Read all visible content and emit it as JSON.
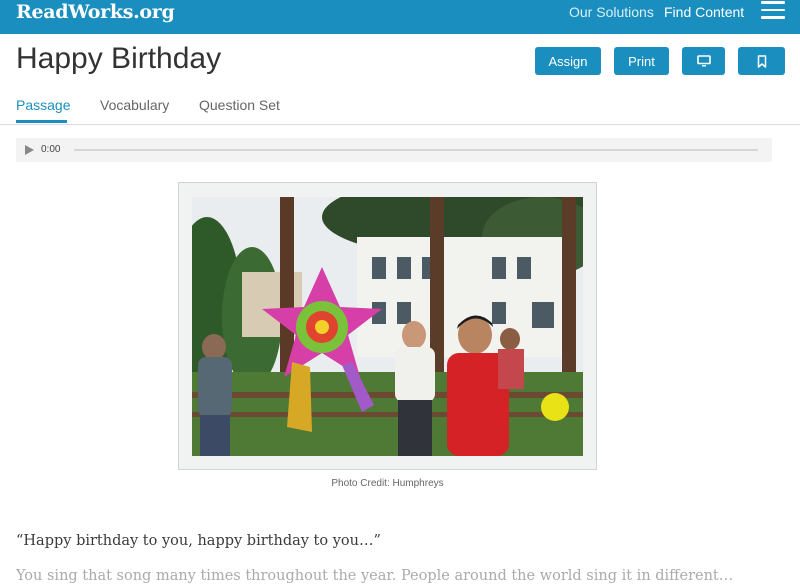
{
  "header": {
    "logo": "ReadWorks.org",
    "nav": {
      "solutions": "Our Solutions",
      "find_content": "Find Content"
    },
    "menu_icon": "hamburger-menu-icon",
    "accent_color": "#1a8fbf"
  },
  "article": {
    "title": "Happy Birthday",
    "actions": {
      "assign": "Assign",
      "print": "Print",
      "present_icon": "monitor-icon",
      "bookmark_icon": "bookmark-icon"
    }
  },
  "tabs": [
    {
      "label": "Passage",
      "active": true
    },
    {
      "label": "Vocabulary",
      "active": false
    },
    {
      "label": "Question Set",
      "active": false
    }
  ],
  "audio": {
    "time": "0:00",
    "progress": 0
  },
  "figure": {
    "caption": "Photo Credit: Humphreys"
  },
  "passage": {
    "paragraphs": [
      "“Happy birthday to you, happy birthday to you…”",
      "You sing that song many times throughout the year. People around the world sing it in different…"
    ]
  }
}
